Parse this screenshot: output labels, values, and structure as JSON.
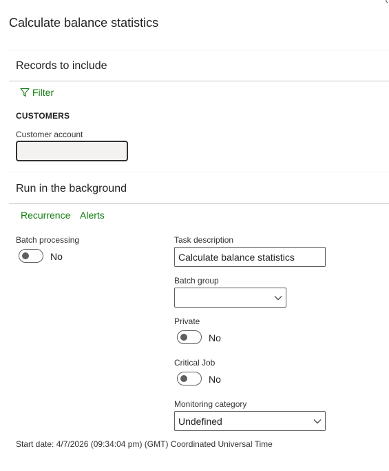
{
  "dialog": {
    "title": "Calculate balance statistics"
  },
  "records": {
    "section_title": "Records to include",
    "filter_label": "Filter",
    "group_label": "CUSTOMERS",
    "customer_account_label": "Customer account",
    "customer_account_value": ""
  },
  "background": {
    "section_title": "Run in the background",
    "recurrence_label": "Recurrence",
    "alerts_label": "Alerts",
    "batch_processing_label": "Batch processing",
    "batch_processing_value": "No",
    "task_description_label": "Task description",
    "task_description_value": "Calculate balance statistics",
    "batch_group_label": "Batch group",
    "batch_group_value": "",
    "private_label": "Private",
    "private_value": "No",
    "critical_job_label": "Critical Job",
    "critical_job_value": "No",
    "monitoring_category_label": "Monitoring category",
    "monitoring_category_value": "Undefined"
  },
  "footer": {
    "start_date": "Start date: 4/7/2026 (09:34:04 pm) (GMT) Coordinated Universal Time"
  },
  "colors": {
    "link": "#107c10",
    "text": "#201f1e",
    "border": "#605e5c"
  },
  "icons": [
    "funnel-icon",
    "chevron-down-icon"
  ]
}
